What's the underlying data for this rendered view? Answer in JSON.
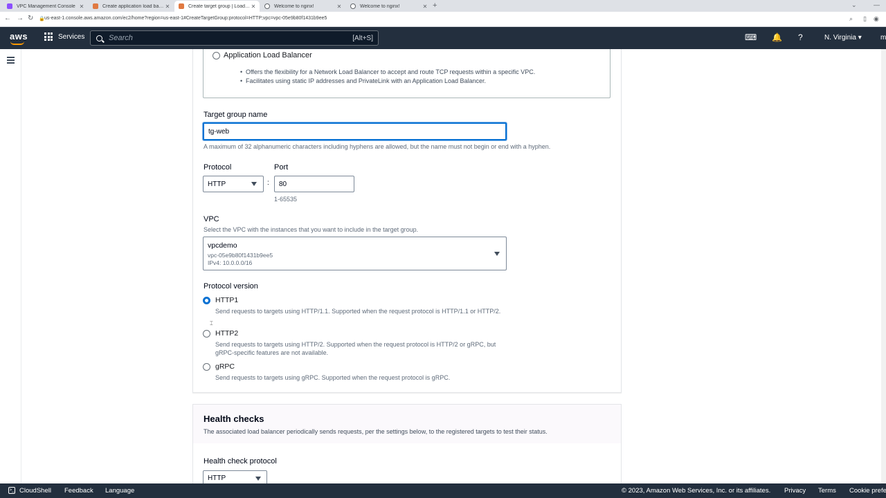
{
  "browser": {
    "tabs": [
      {
        "label": "VPC Management Console",
        "color": "#8c4fff"
      },
      {
        "label": "Create application load balancer",
        "color": "#e07941"
      },
      {
        "label": "Create target group | Load Balancer",
        "color": "#e07941"
      },
      {
        "label": "Welcome to nginx!",
        "color": "#5f6368"
      },
      {
        "label": "Welcome to nginx!",
        "color": "#5f6368"
      }
    ],
    "url": "us-east-1.console.aws.amazon.com/ec2/home?region=us-east-1#CreateTargetGroup:protocol=HTTP;vpc=vpc-05e9b80f1431b9ee5"
  },
  "topnav": {
    "logo": "aws",
    "services": "Services",
    "search_placeholder": "Search",
    "search_hint": "[Alt+S]",
    "region": "N. Virginia",
    "account_initial": "m"
  },
  "form": {
    "alb_option": {
      "label": "Application Load Balancer",
      "bullets": [
        "Offers the flexibility for a Network Load Balancer to accept and route TCP requests within a specific VPC.",
        "Facilitates using static IP addresses and PrivateLink with an Application Load Balancer."
      ]
    },
    "target_group_name": {
      "label": "Target group name",
      "value": "tg-web",
      "hint": "A maximum of 32 alphanumeric characters including hyphens are allowed, but the name must not begin or end with a hyphen."
    },
    "protocol": {
      "label": "Protocol",
      "value": "HTTP"
    },
    "separator": ":",
    "port": {
      "label": "Port",
      "value": "80",
      "hint": "1-65535"
    },
    "vpc": {
      "label": "VPC",
      "description": "Select the VPC with the instances that you want to include in the target group.",
      "name": "vpcdemo",
      "id": "vpc-05e9b80f1431b9ee5",
      "cidr": "IPv4: 10.0.0.0/16"
    },
    "protocol_version": {
      "label": "Protocol version",
      "options": [
        {
          "title": "HTTP1",
          "desc": "Send requests to targets using HTTP/1.1. Supported when the request protocol is HTTP/1.1 or HTTP/2.",
          "checked": true
        },
        {
          "title": "HTTP2",
          "desc": "Send requests to targets using HTTP/2. Supported when the request protocol is HTTP/2 or gRPC, but gRPC-specific features are not available.",
          "checked": false
        },
        {
          "title": "gRPC",
          "desc": "Send requests to targets using gRPC. Supported when the request protocol is gRPC.",
          "checked": false
        }
      ]
    }
  },
  "health_checks": {
    "title": "Health checks",
    "description": "The associated load balancer periodically sends requests, per the settings below, to the registered targets to test their status.",
    "protocol_label": "Health check protocol",
    "protocol_value": "HTTP"
  },
  "footer": {
    "cloudshell": "CloudShell",
    "feedback": "Feedback",
    "language": "Language",
    "copyright": "© 2023, Amazon Web Services, Inc. or its affiliates.",
    "privacy": "Privacy",
    "terms": "Terms",
    "cookie": "Cookie prefer"
  }
}
